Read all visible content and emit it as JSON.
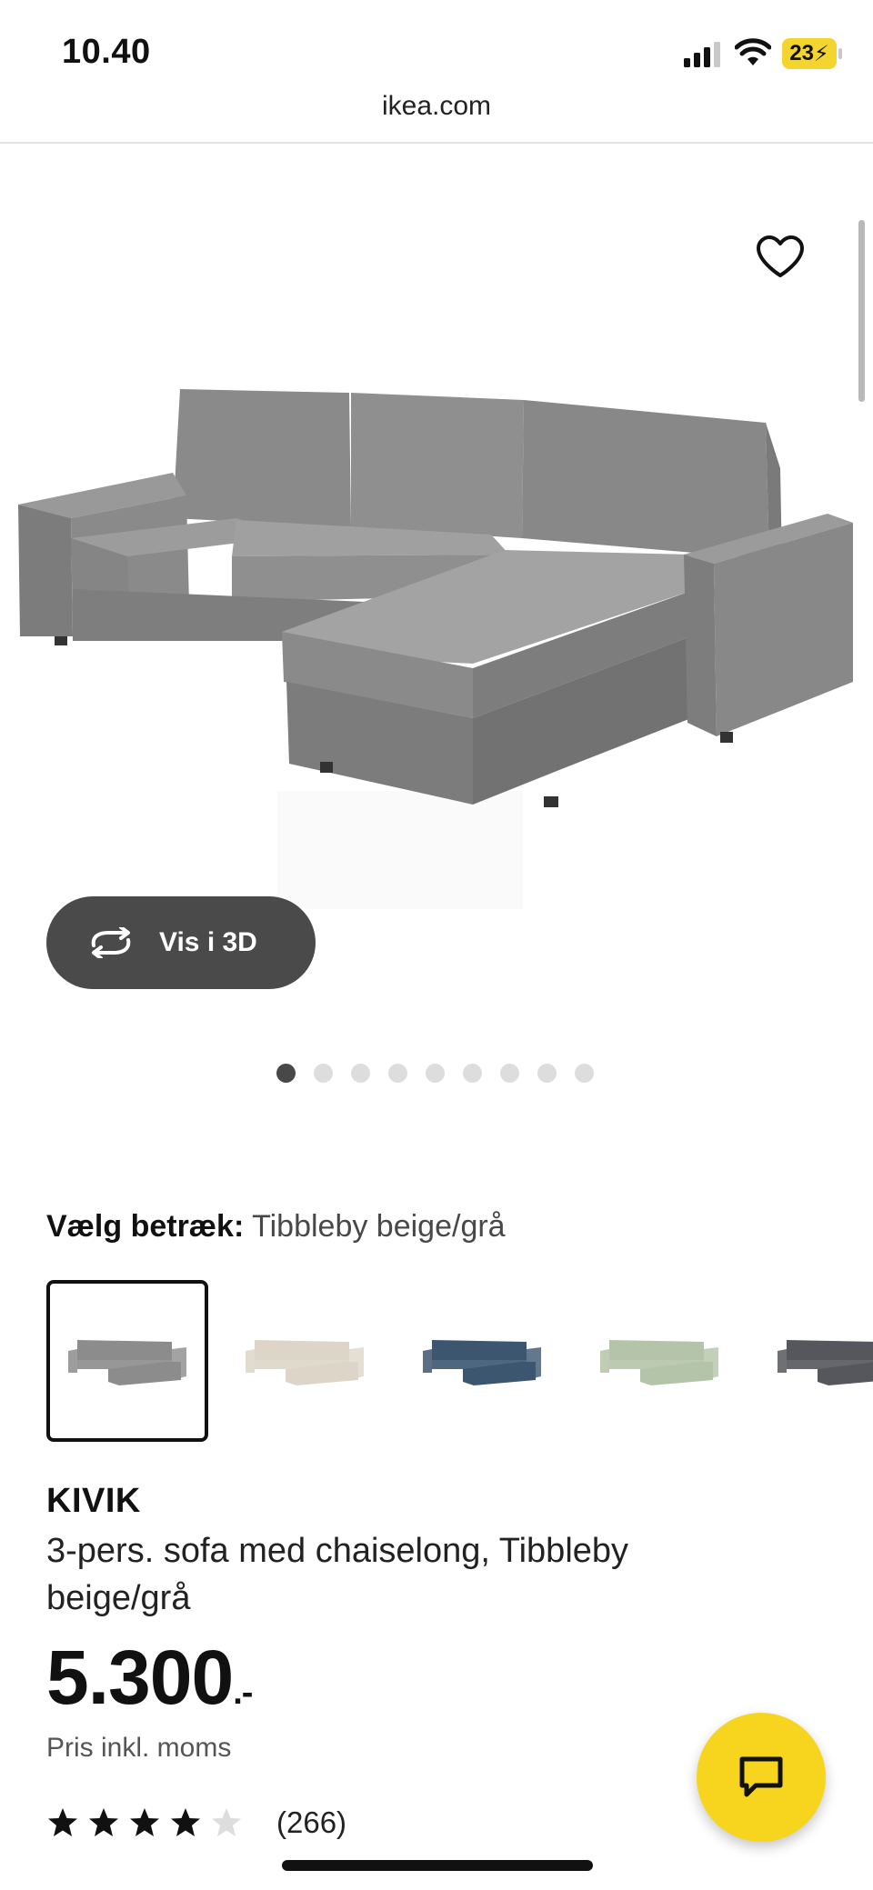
{
  "status_bar": {
    "time": "10.40",
    "battery": "23"
  },
  "browser": {
    "url": "ikea.com"
  },
  "gallery": {
    "view_3d_label": "Vis i 3D",
    "dots_total": 9,
    "active_dot": 1
  },
  "fabric": {
    "label": "Vælg betræk:",
    "selected": "Tibbleby beige/grå",
    "swatches": [
      {
        "color": "#8c8c8c",
        "selected": true
      },
      {
        "color": "#ddd6c8",
        "selected": false
      },
      {
        "color": "#3c5670",
        "selected": false
      },
      {
        "color": "#b4c4a8",
        "selected": false
      },
      {
        "color": "#55575c",
        "selected": false
      }
    ]
  },
  "product": {
    "name": "KIVIK",
    "description": "3-pers. sofa med chaiselong, Tibbleby beige/grå",
    "price": "5.300",
    "price_suffix": ".-",
    "vat_note": "Pris inkl. moms",
    "rating": 4,
    "rating_max": 5,
    "review_count": "(266)"
  },
  "colors": {
    "accent_yellow": "#f7d51e",
    "button_dark": "#4a4a4a",
    "sofa_gray": "#8a8a8a"
  },
  "icons": {
    "favorite": "heart-outline-icon",
    "view_3d": "rotate-arrows-icon",
    "chat": "chat-bubble-icon"
  }
}
